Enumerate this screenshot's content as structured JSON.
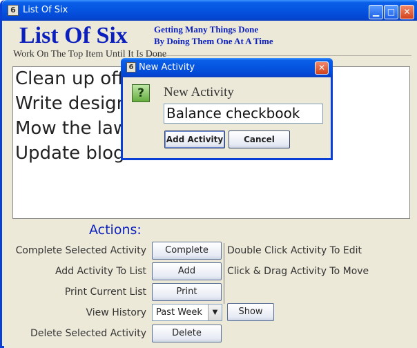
{
  "window": {
    "title": "List Of Six",
    "icon_glyph": "6",
    "minimize_glyph": "▁",
    "maximize_glyph": "□",
    "close_glyph": "✕"
  },
  "header": {
    "brand": "List Of Six",
    "tagline_line1": "Getting Many Things Done",
    "tagline_line2": "By Doing Them One At A Time",
    "subtitle": "Work On The Top Item Until It Is Done"
  },
  "list": {
    "items": [
      "Clean up office",
      "Write design",
      "Mow the lawn",
      "Update blog"
    ]
  },
  "actions": {
    "heading": "Actions:",
    "complete_label": "Complete Selected Activity",
    "complete_button": "Complete",
    "add_label": "Add Activity To List",
    "add_button": "Add",
    "print_label": "Print Current List",
    "print_button": "Print",
    "history_label": "View History",
    "history_selected": "Past Week",
    "show_button": "Show",
    "delete_label": "Delete Selected Activity",
    "delete_button": "Delete",
    "hint_edit": "Double Click Activity To Edit",
    "hint_move": "Click & Drag Activity To Move"
  },
  "dialog": {
    "title": "New Activity",
    "icon_glyph": "6",
    "close_glyph": "✕",
    "question_glyph": "?",
    "label": "New Activity",
    "input_value": "Balance checkbook",
    "add_button": "Add Activity",
    "cancel_button": "Cancel"
  },
  "colors": {
    "accent_blue": "#0a1fbd",
    "titlebar_blue": "#0554e0",
    "window_bg": "#ece9d8"
  }
}
